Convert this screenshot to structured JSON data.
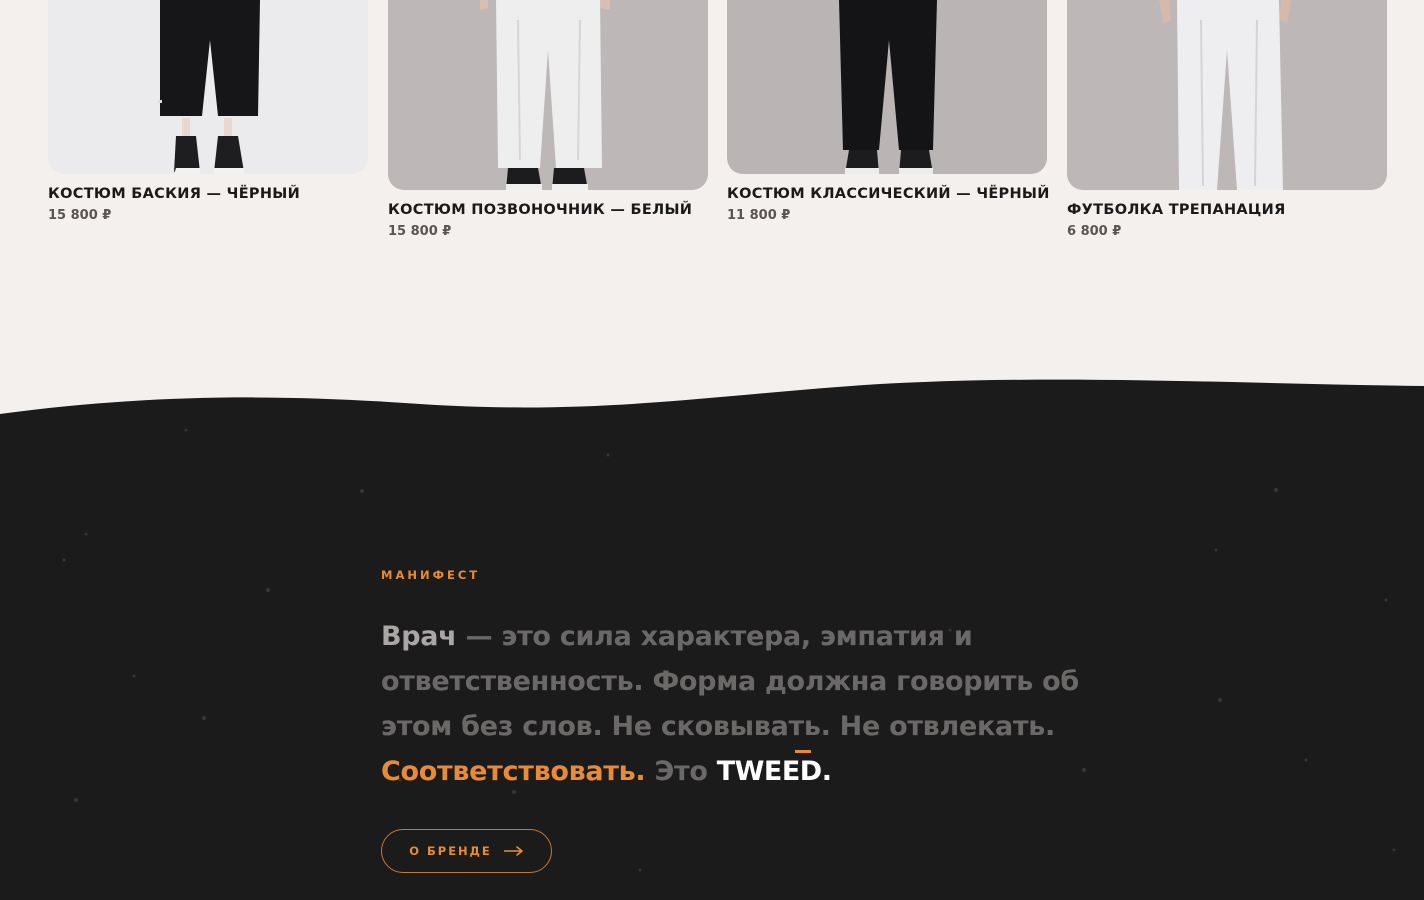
{
  "products": [
    {
      "name": "КОСТЮМ БАСКИЯ — ЧЁРНЫЙ",
      "price": "15 800 ₽",
      "pants": "black"
    },
    {
      "name": "КОСТЮМ ПОЗВОНОЧНИК — БЕЛЫЙ",
      "price": "15 800 ₽",
      "pants": "white"
    },
    {
      "name": "КОСТЮМ КЛАССИЧЕСКИЙ — ЧЁРНЫЙ",
      "price": "11 800 ₽",
      "pants": "black"
    },
    {
      "name": "ФУТБОЛКА ТРЕПАНАЦИЯ",
      "price": "6 800 ₽",
      "pants": "white"
    }
  ],
  "manifest": {
    "label": "МАНИФЕСТ",
    "lead": "Врач",
    "body": " — это сила характера, эмпатия и ответственность. Форма должна говорить об этом без слов. Не сковывать. Не отвлекать. ",
    "accent": "Соответствовать.",
    "tail": " Это ",
    "brand": "TWEED."
  },
  "about_button": {
    "label": "О БРЕНДЕ",
    "icon": "arrow-right-icon"
  },
  "colors": {
    "accent": "#e88b38",
    "dark_bg": "#1c1b1c",
    "light_bg": "#f3f0ed",
    "text_dark": "#1b1a1a"
  }
}
